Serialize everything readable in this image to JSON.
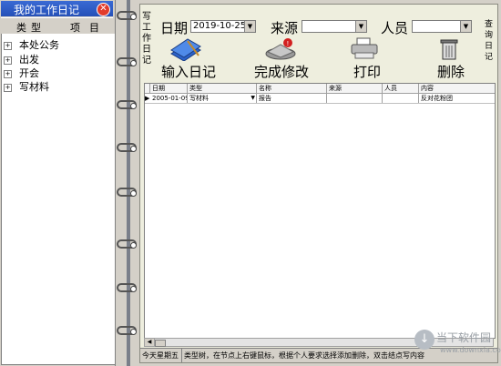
{
  "left_panel": {
    "title": "我的工作日记",
    "close_glyph": "✕",
    "header": {
      "col1": "类型",
      "col2": "项目"
    },
    "tree_items": [
      {
        "expander": "+",
        "label": "本处公务"
      },
      {
        "expander": "+",
        "label": "出发"
      },
      {
        "expander": "+",
        "label": "开会"
      },
      {
        "expander": "+",
        "label": "写材料"
      }
    ]
  },
  "page": {
    "side_left_label": "写工作日记",
    "side_right_label": "查询日记",
    "filters": {
      "date_label": "日期",
      "date_value": "2019-10-25",
      "source_label": "来源",
      "source_value": "",
      "person_label": "人员",
      "person_value": ""
    },
    "toolbar": {
      "input_label": "输入日记",
      "finish_label": "完成修改",
      "print_label": "打印",
      "delete_label": "删除"
    },
    "grid": {
      "columns": [
        "日期",
        "类型",
        "名称",
        "来源",
        "人员",
        "内容"
      ],
      "rows": [
        {
          "indicator": "▶",
          "date": "2005-01-09",
          "type": "写材料",
          "name": "报告",
          "source": "",
          "person": "",
          "content": "反对花粉团"
        }
      ]
    },
    "status": {
      "left": "今天星期五",
      "right": "类型树，在节点上右键鼠标，根据个人要求选择添加删除，双击结点写内容"
    }
  },
  "watermark": {
    "text": "当下软件园",
    "url": "www.downxia.com"
  },
  "colors": {
    "title_bar": "#2f5fc8",
    "page_bg": "#eeeede",
    "window_bg": "#d4d0c8",
    "close_red": "#e23b2b"
  },
  "icons": [
    "close-icon",
    "book-pen-icon",
    "disk-badge-icon",
    "printer-icon",
    "trash-icon",
    "dropdown-arrow-icon"
  ]
}
